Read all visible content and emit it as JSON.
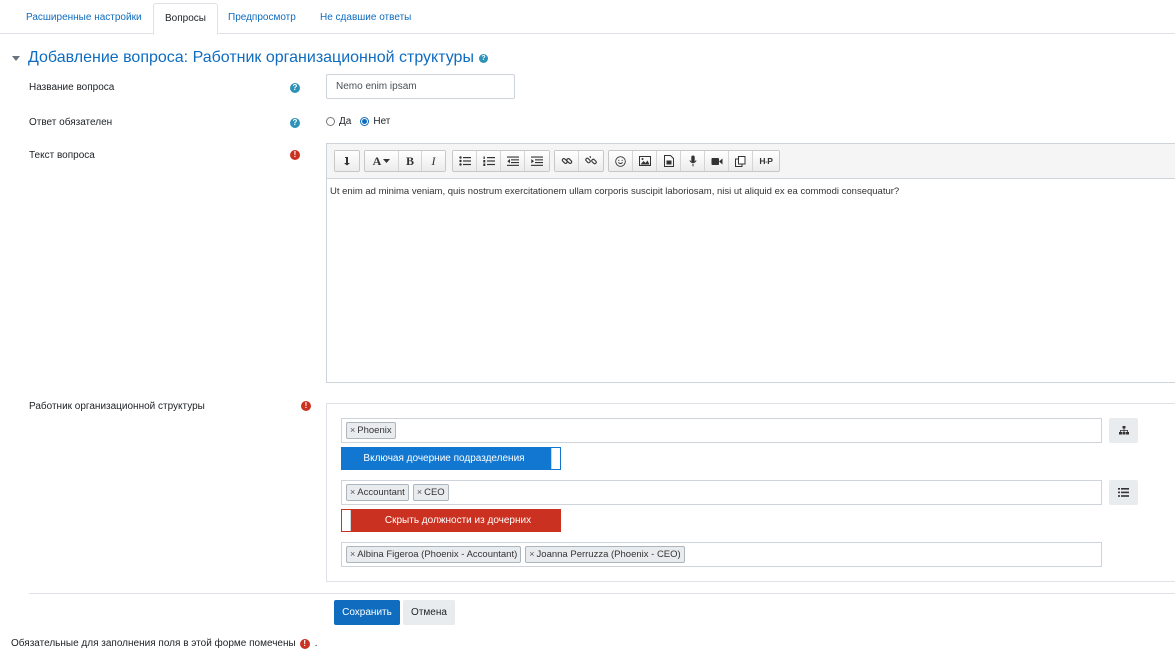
{
  "tabs": [
    {
      "label": "Расширенные настройки",
      "active": false
    },
    {
      "label": "Вопросы",
      "active": true
    },
    {
      "label": "Предпросмотр",
      "active": false
    },
    {
      "label": "Не сдавшие ответы",
      "active": false
    }
  ],
  "section": {
    "title": "Добавление вопроса: Работник организационной структуры"
  },
  "form": {
    "name_label": "Название вопроса",
    "name_value": "Nemo enim ipsam",
    "required_label": "Ответ обязателен",
    "required_options": [
      {
        "label": "Да",
        "checked": false
      },
      {
        "label": "Нет",
        "checked": true
      }
    ],
    "text_label": "Текст вопроса",
    "text_value": "Ut enim ad minima veniam, quis nostrum exercitationem ullam corporis suscipit laboriosam, nisi ut aliquid ex ea commodi consequatur?",
    "org_label": "Работник организационной структуры"
  },
  "org": {
    "units": [
      "Phoenix"
    ],
    "include_children_label": "Включая дочерние подразделения",
    "positions": [
      "Accountant",
      "CEO"
    ],
    "hide_positions_label": "Скрыть должности из дочерних",
    "employees": [
      "Albina Figeroa (Phoenix - Accountant)",
      "Joanna Perruzza (Phoenix - CEO)"
    ]
  },
  "actions": {
    "save_label": "Сохранить",
    "cancel_label": "Отмена"
  },
  "footer": {
    "required_note": "Обязательные для заполнения поля в этой форме помечены",
    "period": "."
  },
  "colors": {
    "link": "#0f6cbf",
    "primary": "#0f6cbf",
    "include_toggle": "#1177d1",
    "hide_toggle": "#ca3120",
    "help": "#2d92b6",
    "required": "#ca3120"
  }
}
